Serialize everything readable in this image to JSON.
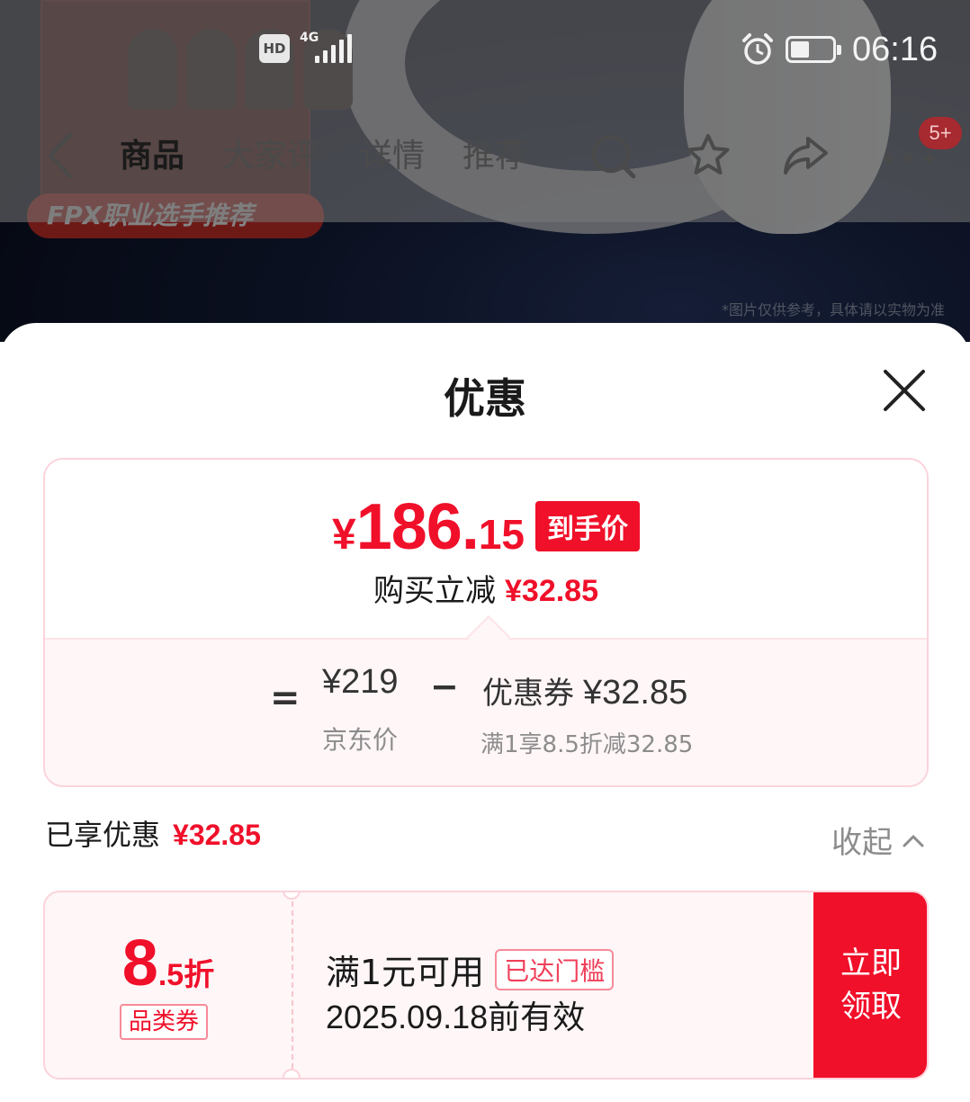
{
  "status_bar": {
    "hd": "HD",
    "network": "4G",
    "time": "06:16",
    "battery_level": 0.45
  },
  "background": {
    "badge_text": "FPX职业选手推荐",
    "note": "*图片仅供参考，具体请以实物为准"
  },
  "nav": {
    "tabs": [
      {
        "label": "商品",
        "active": true
      },
      {
        "label": "大家评",
        "active": false
      },
      {
        "label": "详情",
        "active": false
      },
      {
        "label": "推荐",
        "active": false
      }
    ],
    "icons": [
      "back-icon",
      "search-icon",
      "star-icon",
      "share-icon",
      "more-icon"
    ],
    "message_badge": "5+"
  },
  "sheet": {
    "title": "优惠",
    "price": {
      "yen": "¥",
      "integer": "186.",
      "decimal": "15",
      "tag": "到手价",
      "reduce_label": "购买立减",
      "reduce_amount": "¥32.85"
    },
    "breakdown": {
      "equals": "=",
      "jd_price": "¥219",
      "jd_label": "京东价",
      "minus": "−",
      "coupon_label": "优惠券",
      "coupon_amount": "¥32.85",
      "coupon_desc": "满1享8.5折减32.85"
    },
    "enjoyed": {
      "label": "已享优惠",
      "amount": "¥32.85"
    },
    "collapse_label": "收起",
    "coupon": {
      "discount_int": "8",
      "discount_rest": ".5折",
      "category_tag": "品类券",
      "condition": "满1元可用",
      "reached_tag": "已达门槛",
      "validity": "2025.09.18前有效",
      "claim_line1": "立即",
      "claim_line2": "领取"
    }
  },
  "colors": {
    "accent": "#f0102a",
    "card_border": "#fbd3db",
    "card_bg": "#fff6f7"
  }
}
